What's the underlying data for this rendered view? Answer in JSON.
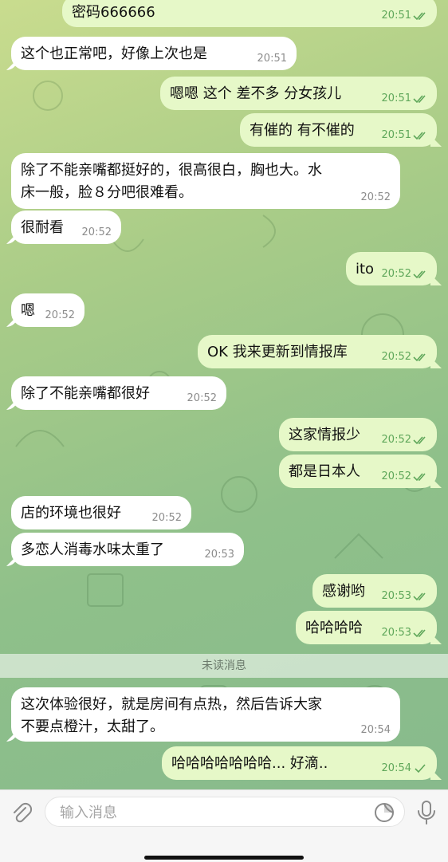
{
  "messages": [
    {
      "text": "密码666666",
      "time": "20:51",
      "dir": "out",
      "read": true
    },
    {
      "text": "这个也正常吧，好像上次也是",
      "time": "20:51",
      "dir": "in"
    },
    {
      "text": "嗯嗯 这个 差不多 分女孩儿",
      "time": "20:51",
      "dir": "out",
      "read": true
    },
    {
      "text": "有催的 有不催的",
      "time": "20:51",
      "dir": "out",
      "read": true
    },
    {
      "text": "除了不能亲嘴都挺好的，很高很白，胸也大。水床一般，脸８分吧很难看。",
      "line1": "除了不能亲嘴都挺好的，很高很白，胸也大。水",
      "line2": "床一般，脸８分吧很难看。",
      "time": "20:52",
      "dir": "in"
    },
    {
      "text": "很耐看",
      "time": "20:52",
      "dir": "in"
    },
    {
      "text": "ito",
      "time": "20:52",
      "dir": "out",
      "read": true
    },
    {
      "text": "嗯",
      "time": "20:52",
      "dir": "in"
    },
    {
      "text": "OK 我来更新到情报库",
      "time": "20:52",
      "dir": "out",
      "read": true
    },
    {
      "text": "除了不能亲嘴都很好",
      "time": "20:52",
      "dir": "in"
    },
    {
      "text": "这家情报少",
      "time": "20:52",
      "dir": "out",
      "read": true
    },
    {
      "text": "都是日本人",
      "time": "20:52",
      "dir": "out",
      "read": true
    },
    {
      "text": "店的环境也很好",
      "time": "20:52",
      "dir": "in"
    },
    {
      "text": "多恋人消毒水味太重了",
      "time": "20:53",
      "dir": "in"
    },
    {
      "text": "感谢哟",
      "time": "20:53",
      "dir": "out",
      "read": true
    },
    {
      "text": "哈哈哈哈",
      "time": "20:53",
      "dir": "out",
      "read": true
    },
    {
      "text": "这次体验很好，就是房间有点热，然后告诉大家不要点橙汁，太甜了。",
      "line1": "这次体验很好，就是房间有点热，然后告诉大家",
      "line2": "不要点橙汁，太甜了。",
      "time": "20:54",
      "dir": "in"
    },
    {
      "text": "哈哈哈哈哈哈哈... 好滴..",
      "time": "20:54",
      "dir": "out",
      "read": false
    }
  ],
  "unread_divider": "未读消息",
  "input": {
    "placeholder": "输入消息"
  },
  "icons": {
    "attach": "paperclip-icon",
    "sticker": "sticker-icon",
    "mic": "microphone-icon",
    "read": "double-check-icon",
    "sent": "single-check-icon"
  },
  "colors": {
    "incoming_bubble": "#ffffff",
    "outgoing_bubble": "#e6f8c8",
    "read_check": "#5fa75a"
  }
}
